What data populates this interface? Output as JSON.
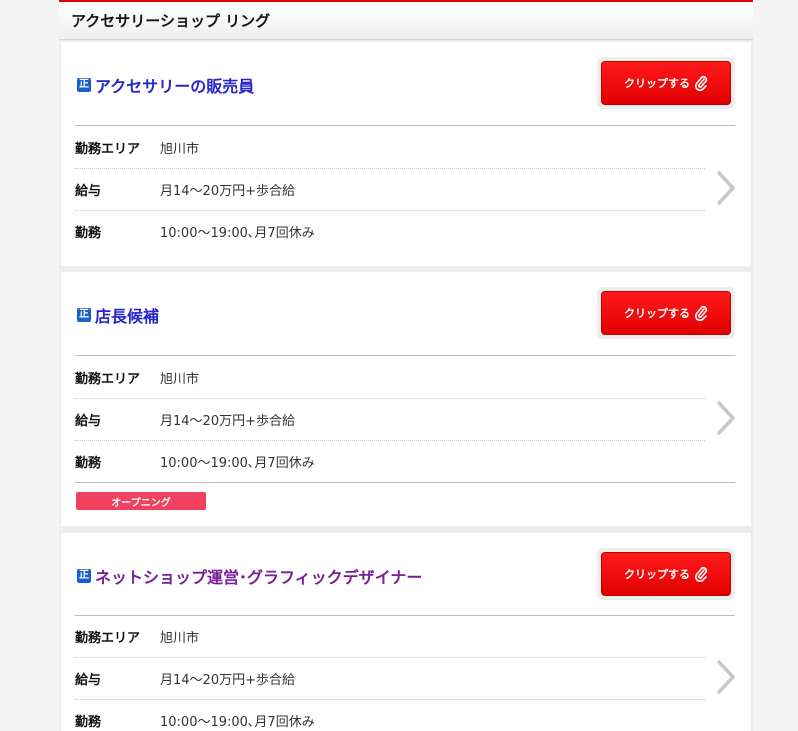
{
  "header": {
    "title": "アクセサリーショップ リング"
  },
  "jobs": [
    {
      "badge": "正",
      "title": "アクセサリーの販売員",
      "clip_label": "クリップする",
      "rows": [
        {
          "label": "勤務エリア",
          "value": "旭川市"
        },
        {
          "label": "給与",
          "value": "月14〜20万円+歩合給"
        },
        {
          "label": "勤務",
          "value": "10:00〜19:00､月7回休み"
        }
      ]
    },
    {
      "badge": "正",
      "title": "店長候補",
      "clip_label": "クリップする",
      "rows": [
        {
          "label": "勤務エリア",
          "value": "旭川市"
        },
        {
          "label": "給与",
          "value": "月14〜20万円+歩合給"
        },
        {
          "label": "勤務",
          "value": "10:00〜19:00､月7回休み"
        }
      ],
      "tag": "オープニング"
    },
    {
      "badge": "正",
      "title": "ネットショップ運営･グラフィックデザイナー",
      "clip_label": "クリップする",
      "rows": [
        {
          "label": "勤務エリア",
          "value": "旭川市"
        },
        {
          "label": "給与",
          "value": "月14〜20万円+歩合給"
        },
        {
          "label": "勤務",
          "value": "10:00〜19:00､月7回休み"
        }
      ]
    }
  ],
  "icons": {
    "clip": "paperclip-icon",
    "detail": "chevron-right-icon"
  },
  "colors": {
    "accent": "#e00000",
    "title_blue": "#2626c9",
    "title_purple": "#7a1e96",
    "tag": "#f04160"
  }
}
